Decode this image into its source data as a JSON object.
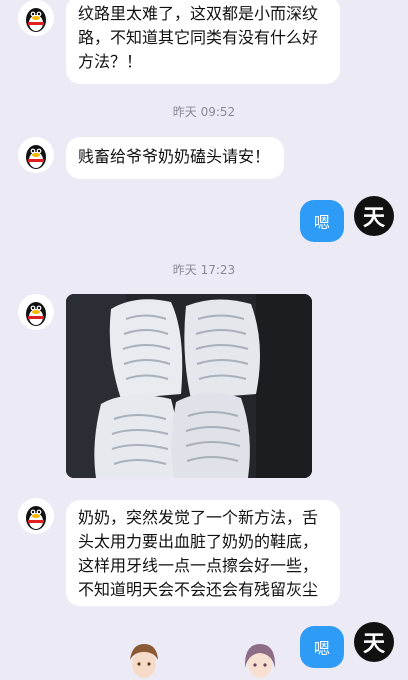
{
  "messages": [
    {
      "sender": "other",
      "text": "纹路里太难了，这双都是小而深纹\n路，不知道其它同类有没有什么好\n方法？！"
    },
    {
      "timestamp": "昨天 09:52"
    },
    {
      "sender": "other",
      "text": "贱畜给爷爷奶奶磕头请安！"
    },
    {
      "sender": "me",
      "text": "嗯"
    },
    {
      "timestamp": "昨天 17:23"
    },
    {
      "sender": "other",
      "type": "image",
      "image_description": "white socks with shoe-sole tread pattern imprints"
    },
    {
      "sender": "other",
      "text": "奶奶，突然发觉了一个新方法，舌\n头太用力要出血脏了奶奶的鞋底，\n这样用牙线一点一点擦会好一些，\n不知道明天会不会还会有残留灰尘"
    },
    {
      "sender": "me",
      "text": "嗯"
    }
  ],
  "my_avatar_char": "天",
  "colors": {
    "background": "#eceaf5",
    "my_bubble": "#2e9bf6",
    "other_bubble": "#ffffff"
  },
  "icons": [
    "qq-penguin-avatar",
    "anime-avatar-brown-hair",
    "anime-avatar-purple-hair"
  ]
}
